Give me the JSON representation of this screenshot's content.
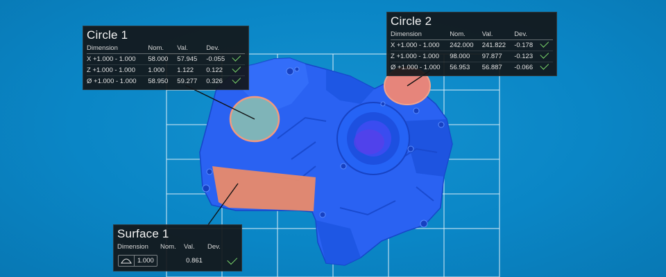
{
  "panels": {
    "circle1": {
      "title": "Circle 1",
      "headers": [
        "Dimension",
        "Nom.",
        "Val.",
        "Dev."
      ],
      "rows": [
        {
          "dim": "X +1.000 - 1.000",
          "nom": "58.000",
          "val": "57.945",
          "dev": "-0.055"
        },
        {
          "dim": "Z +1.000 - 1.000",
          "nom": "1.000",
          "val": "1.122",
          "dev": "0.122"
        },
        {
          "dim": "Ø +1.000 - 1.000",
          "nom": "58.950",
          "val": "59.277",
          "dev": "0.326"
        }
      ]
    },
    "circle2": {
      "title": "Circle 2",
      "headers": [
        "Dimension",
        "Nom.",
        "Val.",
        "Dev."
      ],
      "rows": [
        {
          "dim": "X +1.000 - 1.000",
          "nom": "242.000",
          "val": "241.822",
          "dev": "-0.178"
        },
        {
          "dim": "Z +1.000 - 1.000",
          "nom": "98.000",
          "val": "97.877",
          "dev": "-0.123"
        },
        {
          "dim": "Ø +1.000 - 1.000",
          "nom": "56.953",
          "val": "56.887",
          "dev": "-0.066"
        }
      ]
    },
    "surface1": {
      "title": "Surface 1",
      "headers": [
        "Dimension",
        "Nom.",
        "Val.",
        "Dev."
      ],
      "tolerance": "1.000",
      "val": "0.861",
      "dev_icon": "check-icon"
    }
  },
  "colors": {
    "background": "#0a86c6",
    "part": "#1f5ff0",
    "feature_highlight": "#e98a6a",
    "panel_bg": "#161819",
    "pass_check": "#7bd66b",
    "grid": "#ffffff"
  }
}
